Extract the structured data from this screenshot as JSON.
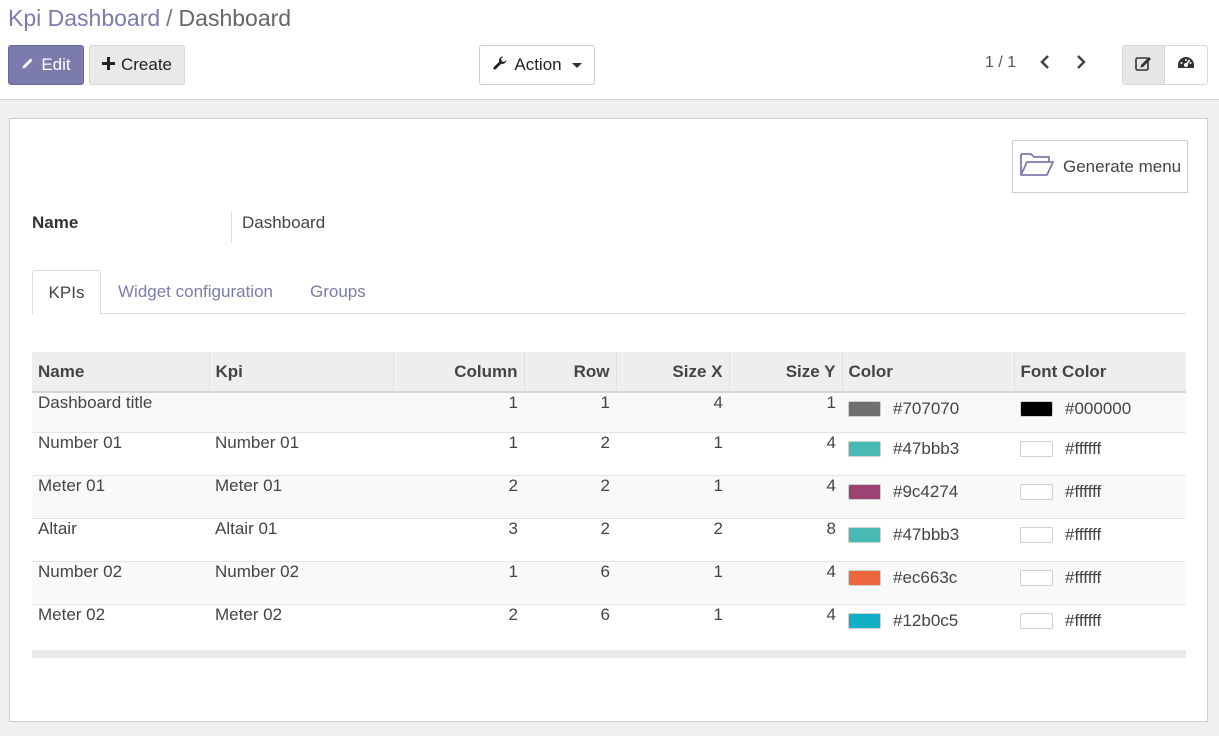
{
  "breadcrumb": {
    "parent": "Kpi Dashboard",
    "separator": "/",
    "current": "Dashboard"
  },
  "toolbar": {
    "edit_label": "Edit",
    "create_label": "Create",
    "action_label": "Action"
  },
  "pager": {
    "text": "1 / 1"
  },
  "form": {
    "generate_menu_label": "Generate menu",
    "name_label": "Name",
    "name_value": "Dashboard",
    "tabs": [
      {
        "label": "KPIs"
      },
      {
        "label": "Widget configuration"
      },
      {
        "label": "Groups"
      }
    ]
  },
  "table": {
    "headers": [
      "Name",
      "Kpi",
      "Column",
      "Row",
      "Size X",
      "Size Y",
      "Color",
      "Font Color"
    ],
    "rows": [
      {
        "name": "Dashboard title",
        "kpi": "",
        "column": "1",
        "row": "1",
        "size_x": "4",
        "size_y": "1",
        "color": "#707070",
        "font_color": "#000000"
      },
      {
        "name": "Number 01",
        "kpi": "Number 01",
        "column": "1",
        "row": "2",
        "size_x": "1",
        "size_y": "4",
        "color": "#47bbb3",
        "font_color": "#ffffff"
      },
      {
        "name": "Meter 01",
        "kpi": "Meter 01",
        "column": "2",
        "row": "2",
        "size_x": "1",
        "size_y": "4",
        "color": "#9c4274",
        "font_color": "#ffffff"
      },
      {
        "name": "Altair",
        "kpi": "Altair 01",
        "column": "3",
        "row": "2",
        "size_x": "2",
        "size_y": "8",
        "color": "#47bbb3",
        "font_color": "#ffffff"
      },
      {
        "name": "Number 02",
        "kpi": "Number 02",
        "column": "1",
        "row": "6",
        "size_x": "1",
        "size_y": "4",
        "color": "#ec663c",
        "font_color": "#ffffff"
      },
      {
        "name": "Meter 02",
        "kpi": "Meter 02",
        "column": "2",
        "row": "6",
        "size_x": "1",
        "size_y": "4",
        "color": "#12b0c5",
        "font_color": "#ffffff"
      }
    ]
  },
  "colors": {
    "brand": "#7c7bad"
  },
  "icons": {
    "edit": "pencil-icon",
    "create": "plus-icon",
    "action": "wrench-icon",
    "prev": "chevron-left-icon",
    "next": "chevron-right-icon",
    "form_view": "form-edit-icon",
    "dashboard_view": "dashboard-gauge-icon",
    "generate": "folder-open-icon"
  }
}
